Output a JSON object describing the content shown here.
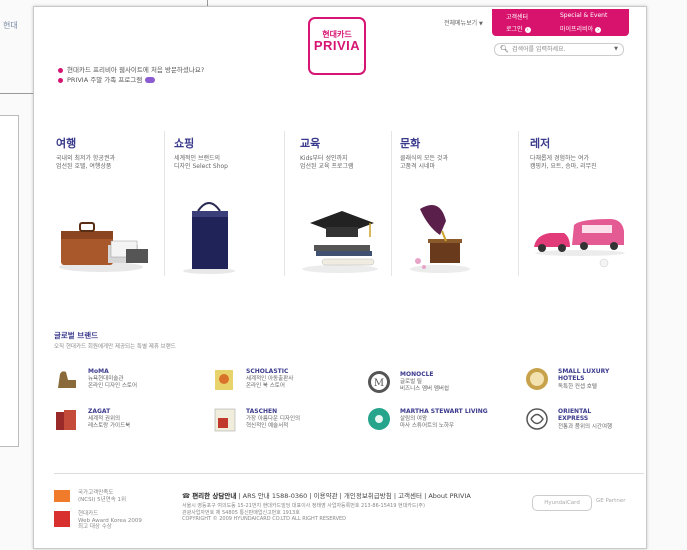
{
  "background": {
    "title": "현대"
  },
  "header": {
    "logo_korean": "현대카드",
    "logo_brand": "PRIVIA",
    "sitemap": "전체메뉴보기",
    "sitemap_icon": "triangle-down",
    "customer_center": "고객센터",
    "special_event": "Special & Event",
    "login": "로그인",
    "my_privia": "마이프리비아",
    "search_placeholder": "검색어를 입력하세요."
  },
  "intro": {
    "q1": "현대카드 프리비아 웹사이트에 처음 방문하셨나요?",
    "q2": "PRIVIA 주말 가족 프로그램"
  },
  "categories": [
    {
      "title": "여행",
      "desc1": "국내외 최저가 항공권과",
      "desc2": "엄선된 호텔, 여행상품"
    },
    {
      "title": "쇼핑",
      "desc1": "세계적인 브랜드의",
      "desc2": "디자인 Select Shop"
    },
    {
      "title": "교육",
      "desc1": "Kids부터 성인까지",
      "desc2": "엄선된 교육 프로그램"
    },
    {
      "title": "문화",
      "desc1": "클래식의 모든 것과",
      "desc2": "고품격 시네마"
    },
    {
      "title": "레저",
      "desc1": "다채롭게 경험하는 여가",
      "desc2": "캠핑카, 요트, 승마, 리무진"
    }
  ],
  "global_brands": {
    "title": "글로벌 브랜드",
    "subtitle": "오직 현대카드 회원에게만 제공되는 특별 제휴 브랜드",
    "items": [
      {
        "name": "MoMA",
        "d1": "뉴욕현대미술관",
        "d2": "온라인 디자인 스토어"
      },
      {
        "name": "SCHOLASTIC",
        "d1": "세계적인 아동출판사",
        "d2": "온라인 북 스토어"
      },
      {
        "name": "MONOCLE",
        "d1": "글로벌 릴",
        "d2": "비즈니스 멤버 멤버쉽"
      },
      {
        "name": "SMALL LUXURY",
        "name2": "HOTELS",
        "d1": "독특한 컨셉 호텔"
      },
      {
        "name": "ZAGAT",
        "d1": "세계적 권위의",
        "d2": "레스토랑 가이드북"
      },
      {
        "name": "TASCHEN",
        "d1": "가장 아름다운 디자인의",
        "d2": "혁신적인 예술서적"
      },
      {
        "name": "MARTHA STEWART LIVING",
        "d1": "살림의 여왕",
        "d2": "마사 스튜어트의 노하우"
      },
      {
        "name": "ORIENTAL",
        "name2": "EXPRESS",
        "d1": "전통과 품위의 시간여행"
      }
    ]
  },
  "footer": {
    "award1_l1": "국가고객만족도",
    "award1_l2": "(NCSI) 5년연속 1위",
    "award2_l1": "현대카드",
    "award2_l2": "Web Award Korea 2009",
    "award2_l3": "최고 대상 수상",
    "main_label": "편리한 상담안내",
    "ars": "ARS 안내 1588-0360",
    "terms": "이용약관",
    "privacy": "개인정보취급방침",
    "cs": "고객센터",
    "about": "About PRIVIA",
    "addr1": "서울시 영등포구 여의도동 15-21번지 현대카드빌딩 대표이사 정태영 사업자등록번호 213-86-15419  현대카드(주)",
    "addr2": "관광사업자번호 제 54805 통신판매업신고번호 1913호",
    "copyright": "COPYRIGHT © 2009 HYUNDAICARD CO.LTD ALL RIGHT RESERVED",
    "partner": "HyundaiCard",
    "partner2": "GE Partner"
  }
}
